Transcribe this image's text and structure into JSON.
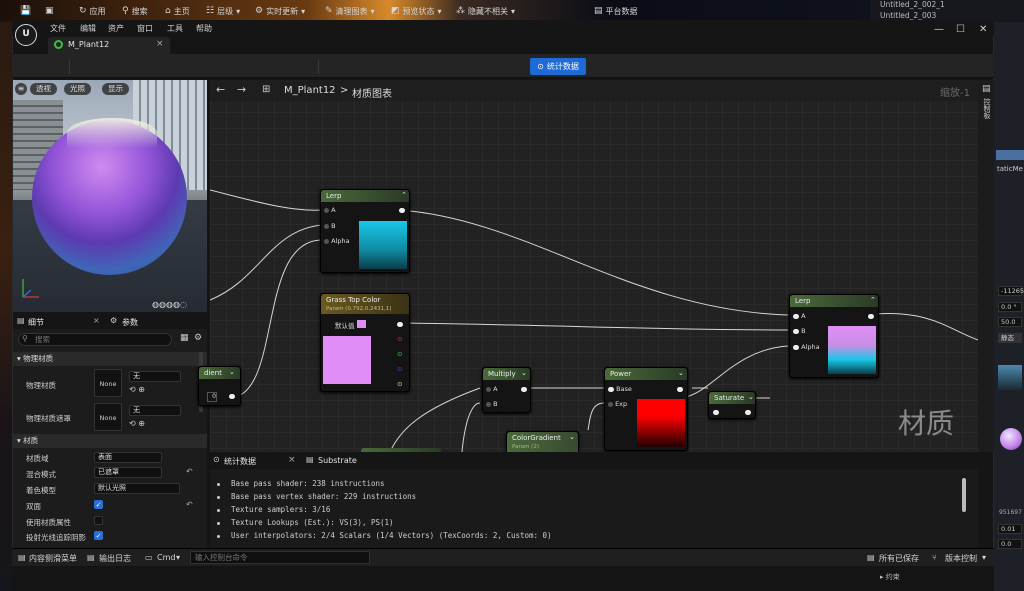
{
  "outliner": {
    "items": [
      "Untitled_2_002_1",
      "Untitled_2_003"
    ]
  },
  "menu": [
    "文件",
    "编辑",
    "资产",
    "窗口",
    "工具",
    "帮助"
  ],
  "window_controls": [
    "—",
    "☐",
    "✕"
  ],
  "tab": {
    "title": "M_Plant12",
    "close": "×"
  },
  "toolbar": {
    "apply": "应用",
    "search": "搜索",
    "home": "主页",
    "hierarchy": "层级",
    "live_update": "实时更新",
    "clean_graph": "清理图表",
    "preview_state": "预览状态",
    "hide_unrelated": "隐藏不相关",
    "stats": "统计数据",
    "platform_stats": "平台数据"
  },
  "viewport": {
    "buttons": [
      "透视",
      "光照",
      "显示"
    ]
  },
  "details": {
    "tab_details": "细节",
    "tab_params": "参数",
    "search_placeholder": "搜索",
    "section_physical": "物理材质",
    "phys_mat_label": "物理材质",
    "phys_mask_label": "物理材质遮罩",
    "none": "None",
    "none_combo": "无",
    "section_material": "材质",
    "domain_label": "材质域",
    "domain_value": "表面",
    "blend_label": "混合模式",
    "blend_value": "已遮罩",
    "shading_label": "着色模型",
    "shading_value": "默认光照",
    "twosided_label": "双面",
    "use_attrs_label": "使用材质属性",
    "cast_ray_label": "投射光线追踪阴影"
  },
  "graph": {
    "breadcrumb_name": "M_Plant12",
    "breadcrumb_sep": ">",
    "breadcrumb_page": "材质图表",
    "zoom": "缩放-1",
    "watermark": "材质",
    "side_label": "控制板",
    "nodes": {
      "lerp1": {
        "title": "Lerp",
        "a": "A",
        "b": "B",
        "alpha": "Alpha",
        "preview_color": "#18c8e6"
      },
      "grass": {
        "title": "Grass Top Color",
        "sub": "Param (0.792,0.2431,1)",
        "default_label": "默认值",
        "swatch": "#e08ef6"
      },
      "gradient_partial": {
        "title": "dient",
        "value": "0"
      },
      "multiply": {
        "title": "Multiply",
        "a": "A",
        "b": "B"
      },
      "power": {
        "title": "Power",
        "base": "Base",
        "exp": "Exp",
        "preview_color": "#ff0000"
      },
      "saturate": {
        "title": "Saturate"
      },
      "lerp2": {
        "title": "Lerp",
        "a": "A",
        "b": "B",
        "alpha": "Alpha",
        "preview_top": "#e08ef6",
        "preview_bottom": "#18c8e6"
      },
      "colorgradient": {
        "title": "ColorGradient",
        "sub": "Param (2)"
      }
    }
  },
  "stats": {
    "tab_stats": "统计数据",
    "tab_substrate": "Substrate",
    "close": "×",
    "lines": [
      "Base pass shader: 238 instructions",
      "Base pass vertex shader: 229 instructions",
      "Texture samplers: 3/16",
      "Texture Lookups (Est.): VS(3), PS(1)",
      "User interpolators: 2/4 Scalars (1/4 Vectors) (TexCoords: 2, Custom: 0)"
    ]
  },
  "bottom": {
    "content_drawer": "内容侧滑菜单",
    "output_log": "输出日志",
    "cmd": "Cmd",
    "cmd_placeholder": "输入控制台命令",
    "save_all": "所有已保存",
    "version_control": "版本控制",
    "constraint": "约束"
  },
  "right_edge": {
    "label": "taticMe",
    "values": [
      "-112650",
      "0.0 °",
      "50.0",
      "静态",
      "0.01",
      "0.0"
    ],
    "extra": "951697"
  }
}
